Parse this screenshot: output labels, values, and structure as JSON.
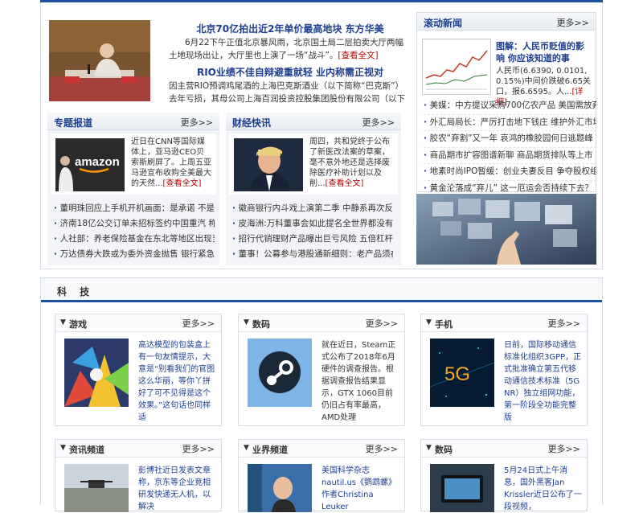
{
  "headline": {
    "items": [
      {
        "title": "北京70亿拍出近2年单价最高地块 东方华美",
        "text": "6月22下午正值北京暴风雨，北京国土局二层拍卖大厅两幅土地现场出让，大厅里也上演了一场“战斗”。",
        "more": "[查看全文]"
      },
      {
        "title": "RIO业绩不佳自辩避重就轻 业内称需正视对",
        "text": "因主营RIO预调鸡尾酒的上海巴克斯酒业（以下简称“巴克斯”）去年亏损，其母公司上海百润投资控股集团股份有限公司（以下简称“百"
      }
    ]
  },
  "zhuanti": {
    "title": "专题报道",
    "more": "更多>>",
    "brand": "amazon",
    "text": "近日在CNN等国际媒体上，亚马逊CEO贝索斯刷屏了。上周五亚马逊宣布收购全美最大的天然...",
    "more_link": "[查看全文]",
    "list": [
      "董明珠回应上手机开机画面：是承诺 不是因",
      "济南18亿公交订单未招标签约中国重汽 称不",
      "人社部：养老保险基金在东北等地区出现当",
      "万达债券大跌或为委外资金抛售 银行紧急开"
    ]
  },
  "caijing": {
    "title": "财经快讯",
    "more": "更多>>",
    "text": "周四，共和党终于公布了新医改法案的草案，毫不意外地还是选择废除医疗补助计划以及削...",
    "more_link": "[查看全文]",
    "list": [
      "徽商银行内斗戏上演第二季 中静系再次反对",
      "皮海洲:万科董事会如此提名全世界都没有",
      "招行代销理财产品曝出巨亏风险 五倍杠杆抽",
      "董事！公募参与港股通新细则：老产品须在"
    ]
  },
  "gundong": {
    "title": "滚动新闻",
    "more": "更多>>",
    "feature_title": "图解：人民币贬值的影响 你应该知道的事",
    "feature_text": "人民币(6.6390, 0.0101, 0.15%)中间价跌破6.65关口，报6.6595。人...",
    "feature_more": "[详细]",
    "list": [
      "美媒：中方提议采购700亿农产品 美国需放弃",
      "外汇局局长：严厉打击地下钱庄 维护外汇市场",
      "胶农“弃割”又一年 哀鸿的橡胶园何日逃题峰",
      "商品期市扩容图谱新聊 商品期货排队等上市",
      "地素时尚IPO暂缓：创业夫妻反目 争夺股权组",
      "黄金沦落成“弃儿” 这一厄运会否持续下去？"
    ]
  },
  "keji": {
    "title": "科 技",
    "cards": [
      {
        "title": "游戏",
        "more": "更多>>",
        "text": "高达模型的包装盒上有一句友情提示，大意是“别看我们的官图这么华丽，等你丫拼好了可不见得是这个效果。”这句话也同样适"
      },
      {
        "title": "数码",
        "more": "更多>>",
        "text": "就在近日，Steam正式公布了2018年6月硬件的调查报告。根据调查报告结果显示，GTX 1060目前仍旧占有率最高，AMD处理"
      },
      {
        "title": "手机",
        "more": "更多>>",
        "text": "日前，国际移动通信标准化组织3GPP，正式批准确立第五代移动通信技术标准（5G NR）独立组网功能，第一阶段全功能完整版",
        "img_label": "5G"
      },
      {
        "title": "资讯频道",
        "more": "更多>>",
        "text": "彭博社近日发表文章称，京东等企业竞相研发快递无人机，以解决"
      },
      {
        "title": "业界频道",
        "more": "更多>>",
        "text": "美国科学杂志nautil.us《鹦鹉螺》作者Christina Leuker"
      },
      {
        "title": "数码",
        "more": "更多>>",
        "text": "5月24日式上午消息，国外黑客Jan Krissler近日公布了一段视频，"
      }
    ]
  },
  "colors": {
    "brand_blue": "#1f4e9e",
    "link_red": "#c00000",
    "title_blue": "#1d3f8f"
  }
}
